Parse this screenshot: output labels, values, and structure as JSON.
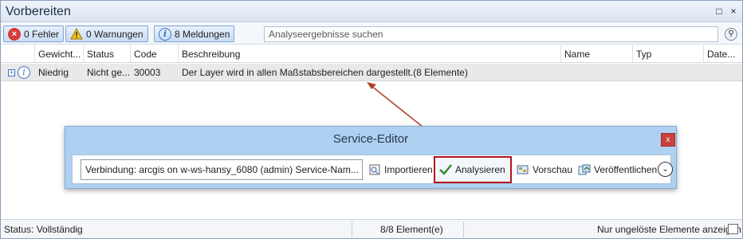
{
  "pane": {
    "title": "Vorbereiten",
    "window_buttons": [
      "□",
      "×"
    ]
  },
  "toolbar": {
    "errors_label": "0 Fehler",
    "warnings_label": "0 Warnungen",
    "messages_label": "8 Meldungen",
    "search_placeholder": "Analyseergebnisse suchen"
  },
  "grid": {
    "columns": [
      "Gewicht...",
      "Status",
      "Code",
      "Beschreibung",
      "Name",
      "Typ",
      "Date..."
    ],
    "rows": [
      {
        "weight": "Niedrig",
        "status": "Nicht ge...",
        "code": "30003",
        "description": "Der Layer wird in allen Maßstabsbereichen dargestellt.(8 Elemente)",
        "name": "",
        "type": "",
        "date": ""
      }
    ]
  },
  "service_editor": {
    "title": "Service-Editor",
    "close_label": "x",
    "connection_text": "Verbindung: arcgis on w-ws-hansy_6080 (admin)   Service-Nam...",
    "import_label": "Importieren",
    "analyze_label": "Analysieren",
    "preview_label": "Vorschau",
    "publish_label": "Veröffentlichen",
    "more_icon": "chevron-down-icon"
  },
  "statusbar": {
    "status": "Status: Vollständig",
    "count": "8/8 Element(e)",
    "unresolved_label": "Nur ungelöste Elemente anzeigen",
    "unresolved_checked": false
  },
  "colors": {
    "highlight_border": "#b3141b",
    "annotation_arrow": "#b0442e",
    "editor_bg": "#afd1f1",
    "error_red": "#d83b3b"
  }
}
